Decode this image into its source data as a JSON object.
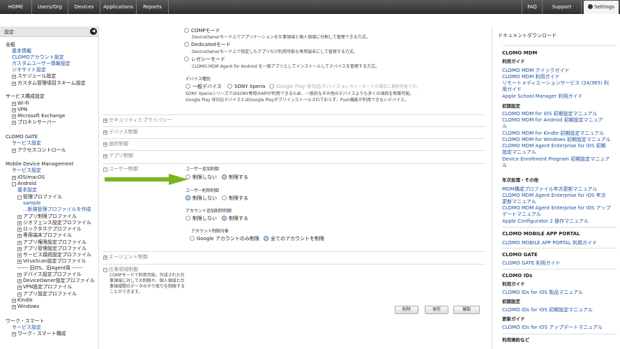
{
  "topnav": {
    "items": [
      "HOME",
      "Users/Org",
      "Devices",
      "Applications",
      "Reports"
    ],
    "right_items": [
      "FAQ",
      "Support"
    ],
    "settings": "Settings"
  },
  "sidebar": {
    "title": "設定",
    "collapse_icon": "chevron-left-icon",
    "lines": [
      {
        "text": "全般",
        "kind": "h"
      },
      {
        "text": "基本情報",
        "kind": "l"
      },
      {
        "text": "CLOMOアカウント設定",
        "kind": "l"
      },
      {
        "text": "カスタムユーザー情報設定",
        "kind": "l"
      },
      {
        "text": "ジオサイト設定",
        "kind": "l"
      },
      {
        "text": "スケジュール設定",
        "kind": "t",
        "exp": "+"
      },
      {
        "text": "カスタム管理項目スキーム設定",
        "kind": "t",
        "exp": "+"
      },
      {
        "text": "サービス構成設定",
        "kind": "h"
      },
      {
        "text": "Wi-Fi",
        "kind": "t",
        "exp": "+"
      },
      {
        "text": "VPN",
        "kind": "t",
        "exp": "+"
      },
      {
        "text": "Microsoft Exchange",
        "kind": "t",
        "exp": "+"
      },
      {
        "text": "プロキシサーバー",
        "kind": "t",
        "exp": "+"
      },
      {
        "text": "CLOMO GATE",
        "kind": "h"
      },
      {
        "text": "サービス設定",
        "kind": "l"
      },
      {
        "text": "アクセスコントロール",
        "kind": "t",
        "exp": "+"
      },
      {
        "text": "Mobile Device Management",
        "kind": "h"
      },
      {
        "text": "サービス設定",
        "kind": "l"
      },
      {
        "text": "iOS/macOS",
        "kind": "t",
        "exp": "+"
      },
      {
        "text": "Android",
        "kind": "t",
        "exp": "-"
      },
      {
        "text": "基本設定",
        "kind": "l"
      },
      {
        "text": "管理プロファイル",
        "kind": "t",
        "exp": "-"
      },
      {
        "text": "sample",
        "kind": "l"
      },
      {
        "text": "...新規管理プロファイルを作成",
        "kind": "l"
      },
      {
        "text": "アプリ制限プロファイル",
        "kind": "t",
        "exp": "+"
      },
      {
        "text": "ジオフェンス設定プロファイル",
        "kind": "t",
        "exp": "+"
      },
      {
        "text": "ロックタスクプロファイル",
        "kind": "t",
        "exp": "+"
      },
      {
        "text": "専用端末プロファイル",
        "kind": "t",
        "exp": "+"
      },
      {
        "text": "アプリ権限設定プロファイル",
        "kind": "t",
        "exp": "+"
      },
      {
        "text": "アプリ管理設定プロファイル",
        "kind": "t",
        "exp": "+"
      },
      {
        "text": "サービス接続設定プロファイル",
        "kind": "t",
        "exp": "+"
      },
      {
        "text": "VirusScan設定プロファイル",
        "kind": "t",
        "exp": "+"
      },
      {
        "text": "------ 旧OS、旧Agent用 ------",
        "kind": "t"
      },
      {
        "text": "デバイス設定プロファイル",
        "kind": "t",
        "exp": "+"
      },
      {
        "text": "DeviceOwner設定プロファイル",
        "kind": "t",
        "exp": "+"
      },
      {
        "text": "VPN設定プロファイル",
        "kind": "t",
        "exp": "+"
      },
      {
        "text": "アプリ設定プロファイル",
        "kind": "t",
        "exp": "+"
      },
      {
        "text": "Kindle",
        "kind": "t",
        "exp": "+"
      },
      {
        "text": "Windows",
        "kind": "t",
        "exp": "+"
      },
      {
        "text": "ワーク・スマート",
        "kind": "h"
      },
      {
        "text": "サービス設定",
        "kind": "l"
      },
      {
        "text": "ワーク・スマート構成",
        "kind": "t",
        "exp": "+"
      }
    ]
  },
  "main": {
    "mode_options": [
      {
        "label": "COMPモード",
        "desc": "DeviceOwnerモード上でアプリケーションを仕事領域と個人領域に分割して管理できる方式。"
      },
      {
        "label": "Dedicatedモード",
        "desc": "DeviceOwnerモード上で指定したアプリだけ利用可能な専用端末にして管理する方式。"
      },
      {
        "label": "レガシーモード",
        "desc": "CLOMO MDM Agent for Android を一般アプリとしてインストールしてデバイスを管理する方式。"
      }
    ],
    "device_type": {
      "label": "デバイス種別",
      "options": [
        "一般デバイス",
        "SONY Xperia",
        "Google Play 非対応デバイス"
      ],
      "note": "※レガシーモードの場合に選択可能です。",
      "desc1": "SONY XperiaシリーズではSONY専用のAPIが利用できるため、一般的なその他のデバイスよりも多くの項目を制御可能。",
      "desc2": "Google Play 非対応デバイスとはGoogle Playがプリインストールされておらず、Push機能が利用できないデバイス。"
    },
    "sections_top": [
      "セキュリティとプライバシー",
      "デバイス制御",
      "通信制御",
      "アプリ制御",
      "ユーザー制御"
    ],
    "user_control": {
      "add_label": "ユーザー追加制御",
      "add_options": [
        "制限しない",
        "制限する"
      ],
      "delete_label": "ユーザー削除制御",
      "delete_options": [
        "制限しない",
        "制限する"
      ],
      "account_label": "アカウント追加削除制御",
      "account_options": [
        "制限しない",
        "制限する"
      ],
      "target_label": "アカウント制限対象",
      "target_options": [
        "Google アカウントのみ制限",
        "全てのアカウントを制限"
      ]
    },
    "agent_section": "エージェント制御",
    "work_section": {
      "title": "仕事領域制御",
      "desc": [
        "COMPモードで利用可能。作成された仕",
        "事領域に対しての制限や、個人領域と仕",
        "事領域間のデータのやり取りを制限する",
        "ことができます。"
      ]
    },
    "buttons": {
      "delete": "削除",
      "save": "保存",
      "copy": "複製"
    },
    "colors": {
      "arrow": "#7ab51d",
      "link": "#1a4fa0",
      "radio_on": "#3b82d8"
    }
  },
  "rpanel": {
    "title": "ドキュメントダウンロード",
    "lines": [
      {
        "text": "CLOMO MDM",
        "kind": "head"
      },
      {
        "text": "利用ガイド",
        "kind": "sub"
      },
      {
        "text": "CLOMO MDM クイックガイド",
        "kind": "link"
      },
      {
        "text": "CLOMO MDM 利用ガイド",
        "kind": "link"
      },
      {
        "text": "リモートメディエーションサービス (24/365) 利",
        "kind": "link"
      },
      {
        "text": "用ガイド",
        "kind": "link"
      },
      {
        "text": "Apple School Manager 利用ガイド",
        "kind": "link"
      },
      {
        "text": "初期設定",
        "kind": "sub"
      },
      {
        "text": "CLOMO MDM for iOS 初期設定マニュアル",
        "kind": "link"
      },
      {
        "text": "CLOMO MDM for Android 初期設定マニュア",
        "kind": "link"
      },
      {
        "text": "ル",
        "kind": "link"
      },
      {
        "text": "CLOMO MDM for Kindle 初期設定マニュアル",
        "kind": "link"
      },
      {
        "text": "CLOMO MDM for Windows 初期設定マニュアル",
        "kind": "link"
      },
      {
        "text": "CLOMO MDM Agent Enterprise for iOS 初期",
        "kind": "link"
      },
      {
        "text": "設定マニュアル",
        "kind": "link"
      },
      {
        "text": "Device Enrollment Program 初期設定マニュア",
        "kind": "link"
      },
      {
        "text": "ル",
        "kind": "link"
      },
      {
        "text": "年次処理・その他",
        "kind": "sub"
      },
      {
        "text": "MDM構成プロファイル年次更新マニュアル",
        "kind": "link"
      },
      {
        "text": "CLOMO MDM Agent Enterprise for iOS 年次",
        "kind": "link"
      },
      {
        "text": "更新マニュアル",
        "kind": "link"
      },
      {
        "text": "CLOMO MDM Agent Enterprise for iOS アップ",
        "kind": "link"
      },
      {
        "text": "デートマニュアル",
        "kind": "link"
      },
      {
        "text": "Apple Configurator 2 操作マニュアル",
        "kind": "link"
      },
      {
        "text": "CLOMO MOBILE APP PORTAL",
        "kind": "head"
      },
      {
        "text": "CLOMO MOBILE APP PORTAL 利用ガイド",
        "kind": "link"
      },
      {
        "text": "CLOMO GATE",
        "kind": "head"
      },
      {
        "text": "CLOMO GATE 利用ガイド",
        "kind": "link"
      },
      {
        "text": "CLOMO IDs",
        "kind": "head"
      },
      {
        "text": "利用ガイド",
        "kind": "sub"
      },
      {
        "text": "CLOMO IDs for iOS 製品マニュアル",
        "kind": "link"
      },
      {
        "text": "初期設定",
        "kind": "sub"
      },
      {
        "text": "CLOMO IDs for iOS 初期設定マニュアル",
        "kind": "link"
      },
      {
        "text": "更新ガイド",
        "kind": "sub"
      },
      {
        "text": "CLOMO IDs for iOS アップデートマニュアル",
        "kind": "link"
      },
      {
        "text": "利用規約など",
        "kind": "sub"
      }
    ]
  }
}
